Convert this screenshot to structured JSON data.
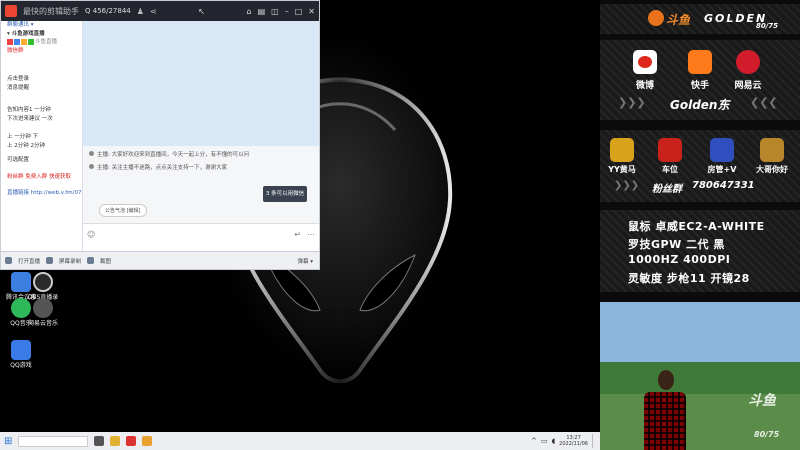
{
  "window": {
    "title": "最快的剪辑助手",
    "title_extra": "Q 456/27844"
  },
  "sidebar": {
    "top_label": "群聊通讯 ▾",
    "group_label": "▾ 斗鱼游戏直播",
    "rows": [
      "斗鱼直播",
      "微信群",
      "点击登录",
      "消息提醒",
      "告知内容1 一分钟",
      "下次进来建议 一次",
      "上 一分钟  下",
      "上 2分钟 2分钟",
      "可选配置",
      "粉丝群  免费入群 快速获取",
      "直播链接 http://web.v.fm/0721/0"
    ]
  },
  "chat": {
    "messages": [
      "主播: 大家好欢迎来到直播间，今天一起上分，有不懂的可以问",
      "主播: 关注主播不迷路，点点关注支持一下，谢谢大家"
    ],
    "send_button": "3 条可以用微信",
    "input_pill": "公告气泡 [编辑]"
  },
  "footer": {
    "items": [
      "打开直播",
      "屏幕录制",
      "截图"
    ],
    "right": "弹幕 ▾"
  },
  "desktop_icons": [
    {
      "label": "腾讯会议客户端"
    },
    {
      "label": "OBS直播录制"
    },
    {
      "label": "QQ音乐"
    },
    {
      "label": "网易云音乐"
    },
    {
      "label": "QQ游戏"
    }
  ],
  "taskbar": {
    "time": "13:27",
    "date": "2022/11/06"
  },
  "overlay": {
    "brand": "斗鱼",
    "brand_en": "GOLDEN",
    "room_tag": "80/75",
    "social": [
      {
        "label": "微博",
        "color": "#e0261c"
      },
      {
        "label": "快手",
        "color": "#ff7a1a"
      },
      {
        "label": "网易云",
        "color": "#d21c2c"
      }
    ],
    "streamer_name": "Golden东",
    "games": [
      {
        "label": "YY黄马",
        "color": "#d9a21b"
      },
      {
        "label": "车位",
        "color": "#c8221b"
      },
      {
        "label": "房管+V",
        "color": "#2f4fbf"
      },
      {
        "label": "大哥你好",
        "color": "#b8862a"
      }
    ],
    "fan_group_label": "粉丝群",
    "fan_group_number": "780647331",
    "specs": [
      "鼠标  卓威EC2-A-WHITE",
      "罗技GPW  二代  黑",
      "1000HZ  400DPI",
      "灵敏度  步枪11  开镜28"
    ],
    "photo_watermark": "斗鱼",
    "photo_room": "80/75"
  }
}
